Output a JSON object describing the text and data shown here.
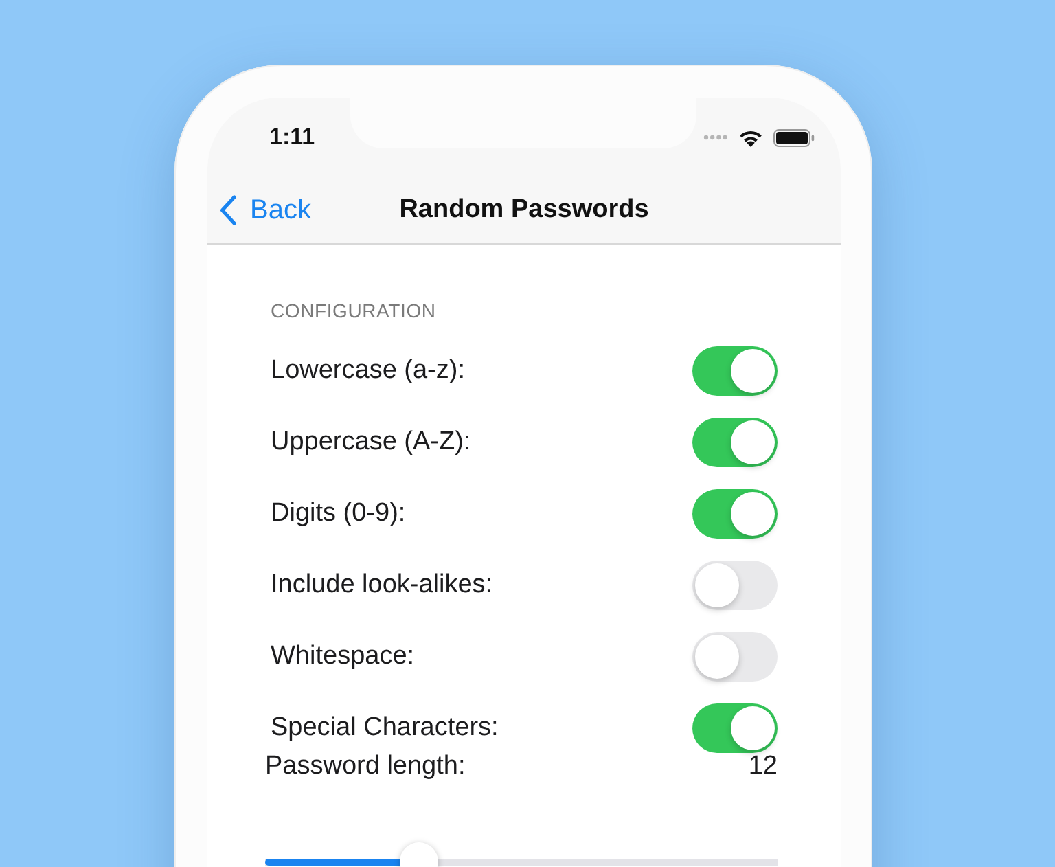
{
  "status_bar": {
    "time": "1:11"
  },
  "nav_bar": {
    "back_label": "Back",
    "title": "Random Passwords"
  },
  "configuration": {
    "header": "CONFIGURATION",
    "options": [
      {
        "label": "Lowercase (a-z):",
        "on": true
      },
      {
        "label": "Uppercase (A-Z):",
        "on": true
      },
      {
        "label": "Digits (0-9):",
        "on": true
      },
      {
        "label": "Include look-alikes:",
        "on": false
      },
      {
        "label": "Whitespace:",
        "on": false
      },
      {
        "label": "Special Characters:",
        "on": true
      }
    ]
  },
  "password_length": {
    "label": "Password length:",
    "value": "12",
    "level": 0.3
  }
}
